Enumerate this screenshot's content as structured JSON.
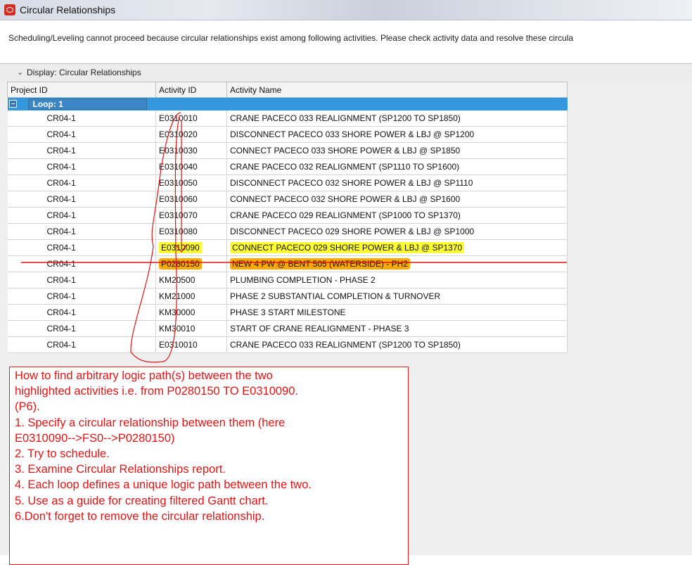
{
  "window": {
    "title": "Circular Relationships"
  },
  "message": "Scheduling/Leveling cannot proceed because circular relationships exist among following activities. Please check activity data and resolve these circula",
  "display": {
    "label": "Display: Circular Relationships"
  },
  "columns": [
    "Project ID",
    "Activity ID",
    "Activity Name"
  ],
  "loop": {
    "label": "Loop: 1"
  },
  "rows": [
    {
      "project": "CR04-1",
      "id": "E0310010",
      "name": "CRANE PACECO 033 REALIGNMENT (SP1200 TO SP1850)"
    },
    {
      "project": "CR04-1",
      "id": "E0310020",
      "name": "DISCONNECT PACECO 033 SHORE POWER & LBJ @ SP1200"
    },
    {
      "project": "CR04-1",
      "id": "E0310030",
      "name": "CONNECT PACECO 033 SHORE POWER & LBJ @ SP1850"
    },
    {
      "project": "CR04-1",
      "id": "E0310040",
      "name": "CRANE PACECO 032 REALIGNMENT (SP1110 TO SP1600)"
    },
    {
      "project": "CR04-1",
      "id": "E0310050",
      "name": "DISCONNECT PACECO 032 SHORE POWER & LBJ @ SP1110"
    },
    {
      "project": "CR04-1",
      "id": "E0310060",
      "name": "CONNECT PACECO 032 SHORE POWER & LBJ @ SP1600"
    },
    {
      "project": "CR04-1",
      "id": "E0310070",
      "name": "CRANE PACECO 029 REALIGNMENT (SP1000 TO SP1370)"
    },
    {
      "project": "CR04-1",
      "id": "E0310080",
      "name": "DISCONNECT PACECO 029 SHORE POWER & LBJ @ SP1000"
    },
    {
      "project": "CR04-1",
      "id": "E0310090",
      "name": "CONNECT PACECO 029 SHORE POWER & LBJ @ SP1370"
    },
    {
      "project": "CR04-1",
      "id": "P0280150",
      "name": "NEW 4 PW @ BENT 505 (WATERSIDE) - PH2"
    },
    {
      "project": "CR04-1",
      "id": "KM20500",
      "name": "PLUMBING COMPLETION - PHASE 2"
    },
    {
      "project": "CR04-1",
      "id": "KM21000",
      "name": "PHASE 2 SUBSTANTIAL COMPLETION & TURNOVER"
    },
    {
      "project": "CR04-1",
      "id": "KM30000",
      "name": "PHASE 3 START MILESTONE"
    },
    {
      "project": "CR04-1",
      "id": "KM30010",
      "name": "START OF CRANE REALIGNMENT - PHASE 3"
    },
    {
      "project": "CR04-1",
      "id": "E0310010",
      "name": "CRANE PACECO 033 REALIGNMENT (SP1200 TO SP1850)"
    }
  ],
  "annotation": {
    "lines": [
      "How to find arbitrary logic path(s) between the two",
      "highlighted activities i.e. from P0280150 TO E0310090.",
      "(P6).",
      "1. Specify a circular relationship between them (here",
      "E0310090-->FS0-->P0280150)",
      "2. Try to schedule.",
      "3. Examine Circular Relationships report.",
      "4. Each loop defines a unique logic path between the two.",
      "5. Use as a guide for creating filtered Gantt chart.",
      "6.Don't forget to remove the circular relationship."
    ]
  },
  "colors": {
    "loop_row": "#3398dd",
    "highlight_yellow": "#ffff33",
    "highlight_orange": "#ffa800",
    "annotation_red": "#e01515"
  }
}
